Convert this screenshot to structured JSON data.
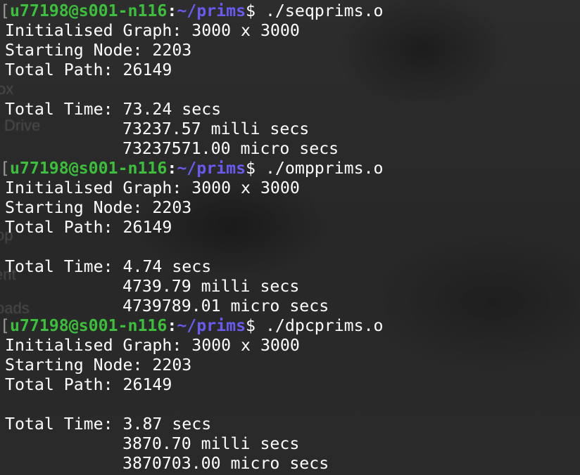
{
  "terminal": {
    "blocks": [
      {
        "prompt": {
          "bracket": "[",
          "user_host": "u77198@s001-n116",
          "colon": ":",
          "path": "~/prims",
          "dollar": "$",
          "command": " ./seqprims.o"
        },
        "graph_line": "Initialised Graph: 3000 x 3000",
        "start_line": "Starting Node: 2203",
        "path_line": "Total Path: 26149",
        "time_line": "Total Time: 73.24 secs",
        "milli_line": "73237.57 milli secs",
        "micro_line": "73237571.00 micro secs"
      },
      {
        "prompt": {
          "bracket": "[",
          "user_host": "u77198@s001-n116",
          "colon": ":",
          "path": "~/prims",
          "dollar": "$",
          "command": " ./ompprims.o"
        },
        "graph_line": "Initialised Graph: 3000 x 3000",
        "start_line": "Starting Node: 2203",
        "path_line": "Total Path: 26149",
        "time_line": "Total Time: 4.74 secs",
        "milli_line": "4739.79 milli secs",
        "micro_line": "4739789.01 micro secs"
      },
      {
        "prompt": {
          "bracket": "[",
          "user_host": "u77198@s001-n116",
          "colon": ":",
          "path": "~/prims",
          "dollar": "$",
          "command": " ./dpcprims.o"
        },
        "graph_line": "Initialised Graph: 3000 x 3000",
        "start_line": "Starting Node: 2203",
        "path_line": "Total Path: 26149",
        "time_line": "Total Time: 3.87 secs",
        "milli_line": "3870.70 milli secs",
        "micro_line": "3870703.00 micro secs"
      }
    ]
  },
  "background_ghost_text": [
    "ox",
    "Drive",
    "op",
    "ent",
    "oads"
  ],
  "colors": {
    "background": "#2b2b2b",
    "text": "#ffffff",
    "user_host": "#3cc03c",
    "path": "#6a5bf0"
  }
}
